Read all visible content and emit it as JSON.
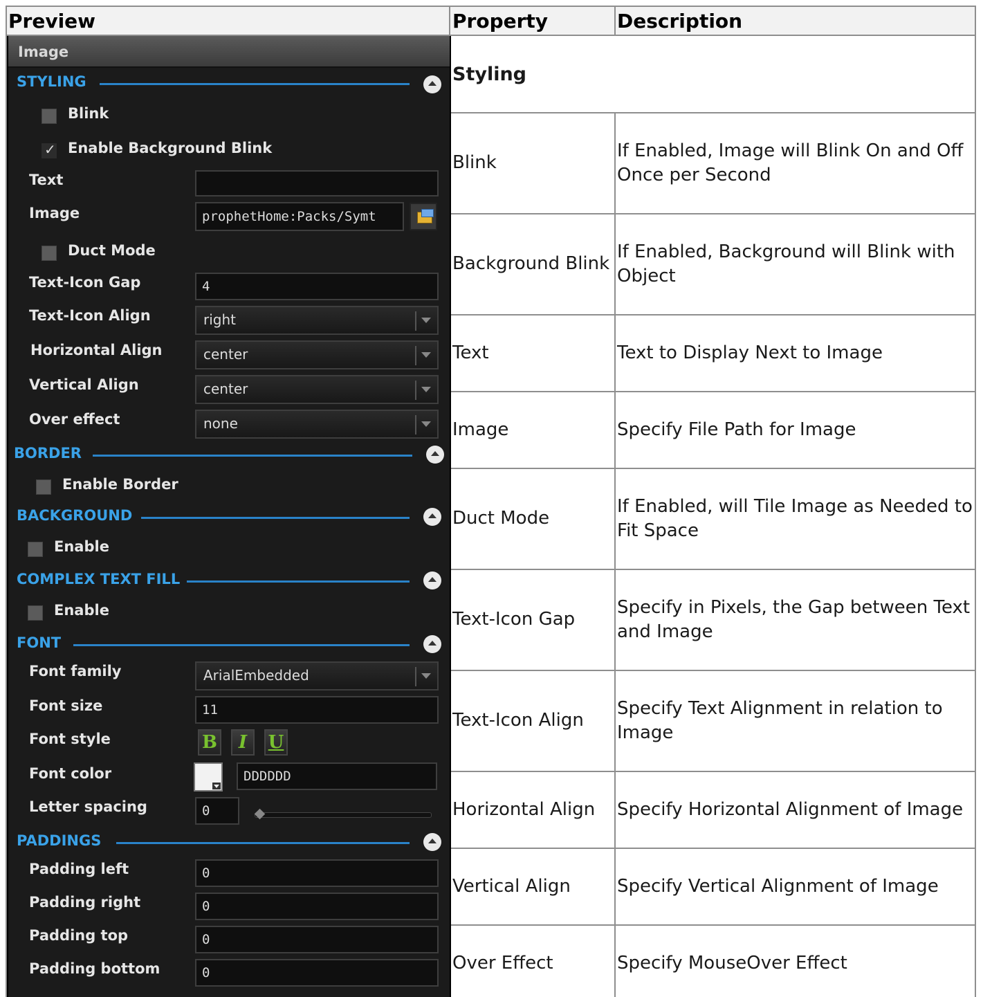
{
  "table": {
    "headers": [
      "Preview",
      "Property",
      "Description"
    ],
    "rows": [
      {
        "property": "Styling",
        "description": "",
        "section": true
      },
      {
        "property": "Blink",
        "description": "If Enabled, Image will Blink On and Off Once per Second"
      },
      {
        "property": "Background Blink",
        "description": "If Enabled, Background will Blink with Object"
      },
      {
        "property": "Text",
        "description": "Text to Display Next to Image"
      },
      {
        "property": "Image",
        "description": "Specify File Path for Image"
      },
      {
        "property": "Duct Mode",
        "description": "If Enabled, will Tile Image as Needed to Fit Space"
      },
      {
        "property": "Text-Icon Gap",
        "description": "Specify in Pixels, the Gap between Text and Image"
      },
      {
        "property": "Text-Icon Align",
        "description": "Specify Text Alignment in relation to Image"
      },
      {
        "property": "Horizontal Align",
        "description": "Specify Horizontal Alignment of Image"
      },
      {
        "property": "Vertical Align",
        "description": "Specify Vertical Alignment of Image"
      },
      {
        "property": "Over Effect",
        "description": "Specify MouseOver Effect"
      }
    ]
  },
  "panel": {
    "title": "Image",
    "sections": {
      "styling": "STYLING",
      "border": "BORDER",
      "background": "BACKGROUND",
      "complex_text_fill": "COMPLEX TEXT FILL",
      "font": "FONT",
      "paddings": "PADDINGS"
    },
    "styling": {
      "blink_label": "Blink",
      "blink_checked": false,
      "bg_blink_label": "Enable Background Blink",
      "bg_blink_checked": true,
      "text_label": "Text",
      "text_value": "",
      "image_label": "Image",
      "image_value": "prophetHome:Packs/Symt",
      "duct_label": "Duct Mode",
      "duct_checked": false,
      "gap_label": "Text-Icon Gap",
      "gap_value": "4",
      "ti_align_label": "Text-Icon Align",
      "ti_align_value": "right",
      "h_align_label": "Horizontal Align",
      "h_align_value": "center",
      "v_align_label": "Vertical Align",
      "v_align_value": "center",
      "over_label": "Over effect",
      "over_value": "none"
    },
    "border": {
      "enable_label": "Enable Border",
      "checked": false
    },
    "background": {
      "enable_label": "Enable",
      "checked": false
    },
    "complex_text_fill": {
      "enable_label": "Enable",
      "checked": false
    },
    "font": {
      "family_label": "Font family",
      "family_value": "ArialEmbedded",
      "size_label": "Font size",
      "size_value": "11",
      "style_label": "Font style",
      "style_bold": "B",
      "style_italic": "I",
      "style_underline": "U",
      "color_label": "Font color",
      "color_value": "DDDDDD",
      "color_swatch": "#f2f2f2",
      "spacing_label": "Letter spacing",
      "spacing_value": "0"
    },
    "paddings": {
      "left_label": "Padding left",
      "left_value": "0",
      "right_label": "Padding right",
      "right_value": "0",
      "top_label": "Padding top",
      "top_value": "0",
      "bottom_label": "Padding bottom",
      "bottom_value": "0"
    }
  },
  "colors": {
    "accent": "#3aa2e8",
    "panel_bg": "#1b1b1b",
    "button_green": "#79c22f"
  }
}
